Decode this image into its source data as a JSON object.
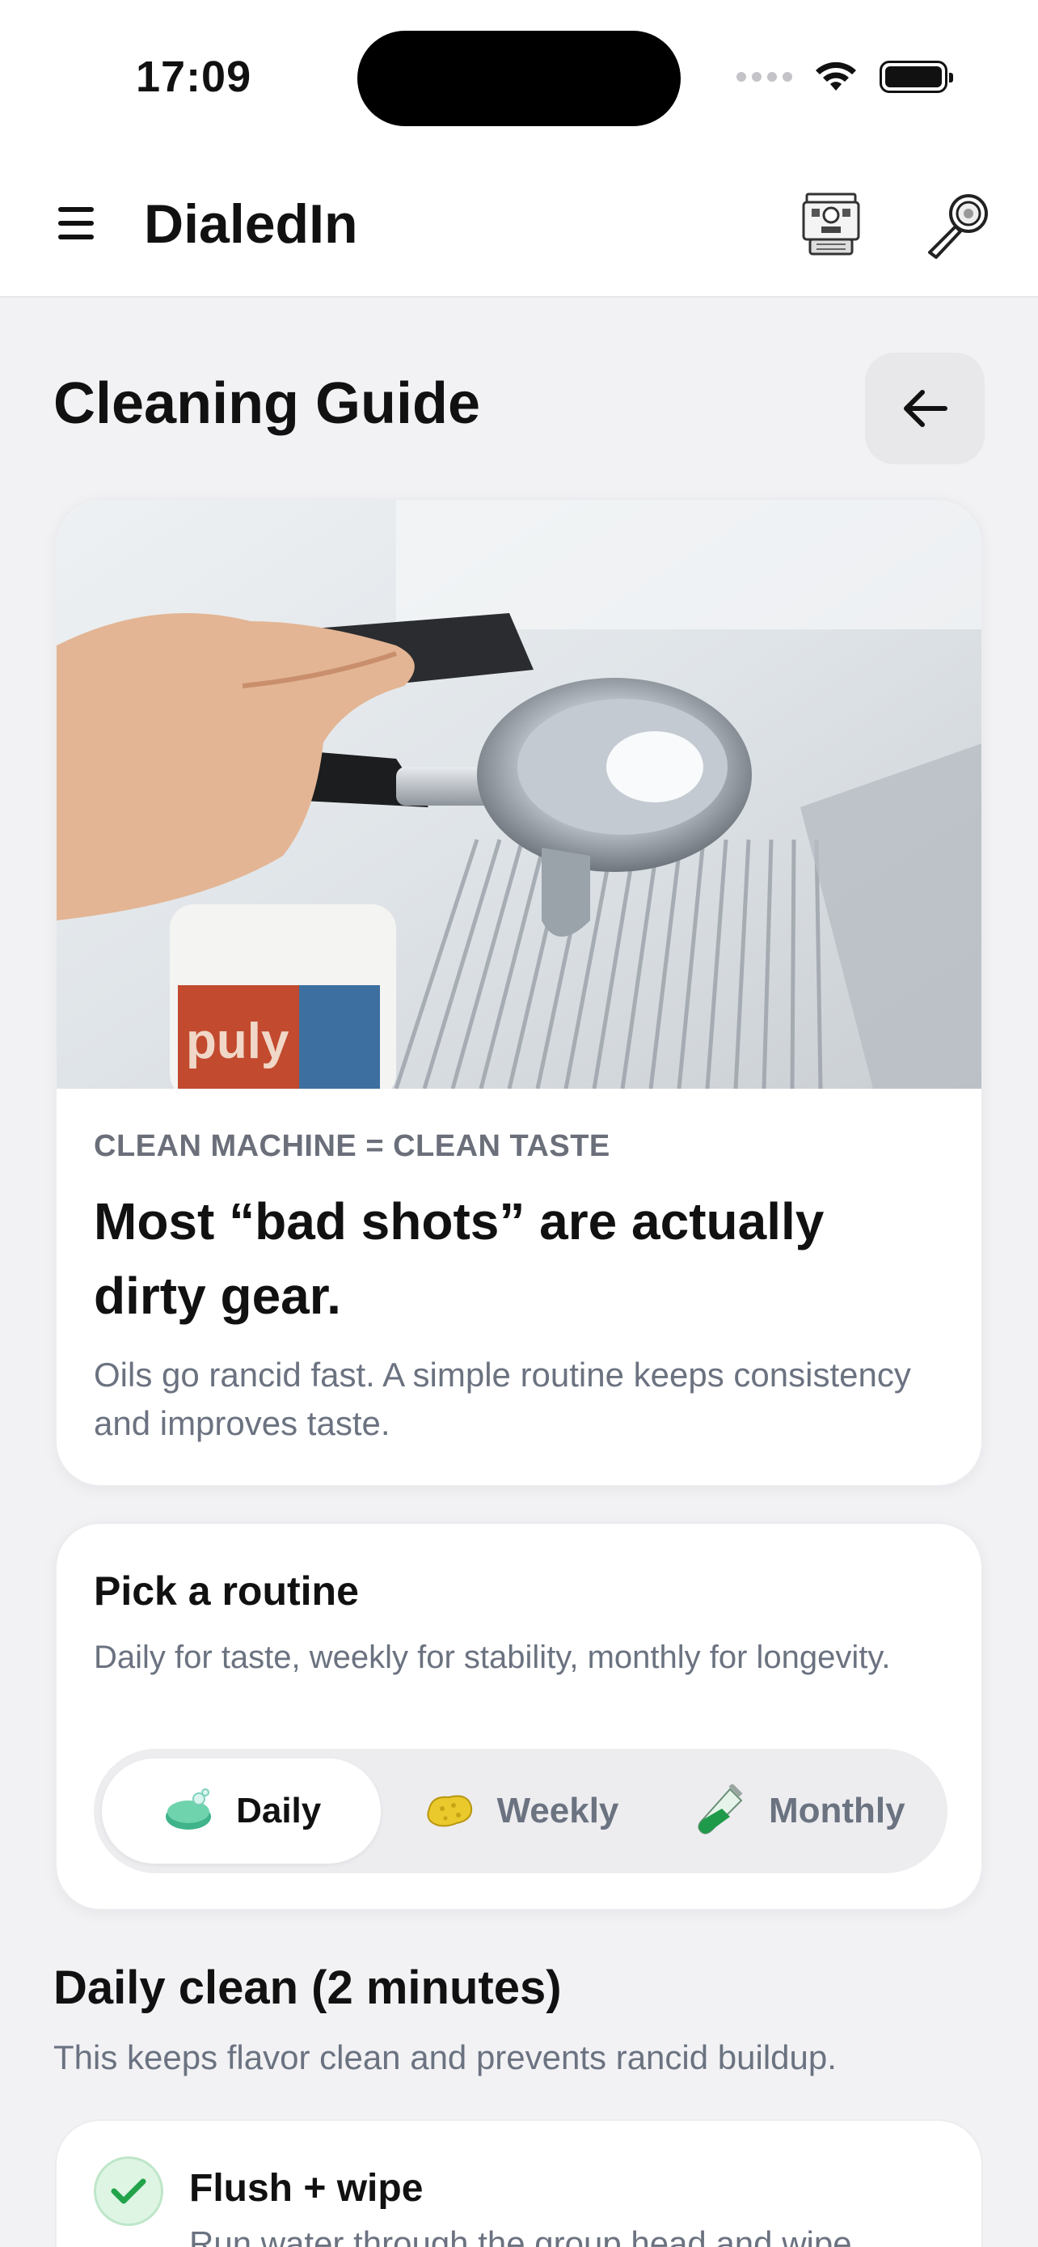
{
  "status_bar": {
    "time": "17:09"
  },
  "app_header": {
    "title": "DialedIn"
  },
  "page": {
    "title": "Cleaning Guide"
  },
  "hero": {
    "eyebrow": "CLEAN MACHINE = CLEAN TASTE",
    "heading": "Most “bad shots” are actually dirty gear.",
    "body": "Oils go rancid fast. A simple routine keeps consistency and improves taste.",
    "image_alt": "Portafilter with cleaning tablet over espresso machine drip tray"
  },
  "routine": {
    "title": "Pick a routine",
    "subtitle": "Daily for taste, weekly for stability, monthly for longevity.",
    "options": [
      {
        "label": "Daily",
        "icon": "soap-icon",
        "active": true
      },
      {
        "label": "Weekly",
        "icon": "sponge-icon",
        "active": false
      },
      {
        "label": "Monthly",
        "icon": "test-tube-icon",
        "active": false
      }
    ]
  },
  "daily": {
    "title": "Daily clean (2 minutes)",
    "subtitle": "This keeps flavor clean and prevents rancid buildup.",
    "tasks": [
      {
        "title": "Flush + wipe",
        "description": "Run water through the group head and wipe",
        "done": true
      }
    ]
  },
  "colors": {
    "accent_green": "#22a34a",
    "muted_text": "#6b7280",
    "background": "#f2f2f5"
  }
}
